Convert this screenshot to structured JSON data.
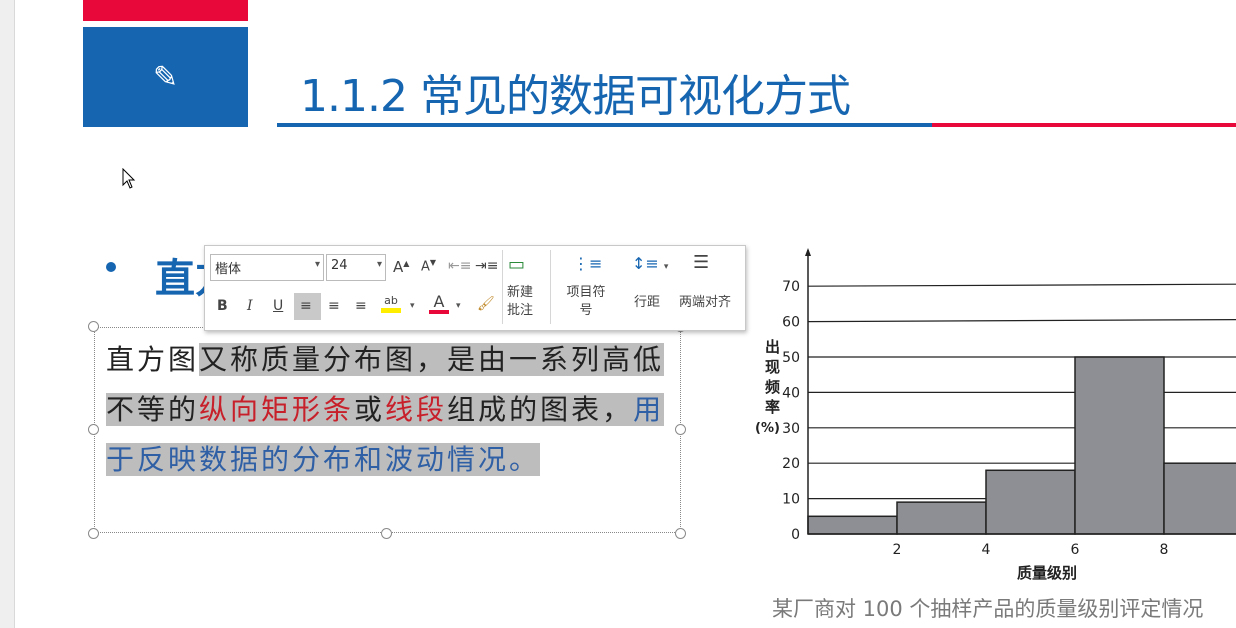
{
  "slide": {
    "title": "1.1.2 常见的数据可视化方式",
    "icon": "pencil-icon",
    "heading": "直方图",
    "paragraph": {
      "p1": "直方图",
      "p2": "又称质量分布图，是由一系列高低不等的",
      "p3": "纵向矩形条",
      "p4": "或",
      "p5": "线段",
      "p6": "组成的图表，",
      "p7": "用于反映数据的分布和波动情况。"
    },
    "caption": "某厂商对 100 个抽样产品的质量级别评定情况"
  },
  "toolbar": {
    "font_name": "楷体",
    "font_size": "24",
    "grow_font": "A",
    "shrink_font": "A",
    "bold": "B",
    "italic": "I",
    "underline": "U",
    "highlight_label": "ab",
    "font_color_label": "A",
    "new_comment": "新建批注",
    "bullets": "项目符号",
    "line_spacing": "行距",
    "justify": "两端对齐"
  },
  "colors": {
    "brand_blue": "#1565b1",
    "brand_red": "#e8083a",
    "highlight_yellow": "#ffee00",
    "font_red": "#e8083a"
  },
  "chart_data": {
    "type": "bar",
    "title": "",
    "xlabel": "质量级别",
    "ylabel": "出现频率(%)",
    "bins": [
      [
        0,
        2
      ],
      [
        2,
        4
      ],
      [
        4,
        6
      ],
      [
        6,
        8
      ],
      [
        8,
        10
      ]
    ],
    "values": [
      5,
      9,
      18,
      50,
      20
    ],
    "x_ticks": [
      2,
      4,
      6,
      8
    ],
    "y_ticks": [
      0,
      10,
      20,
      30,
      40,
      50,
      60,
      70
    ],
    "ylim": [
      0,
      75
    ],
    "grid": "horizontal"
  }
}
